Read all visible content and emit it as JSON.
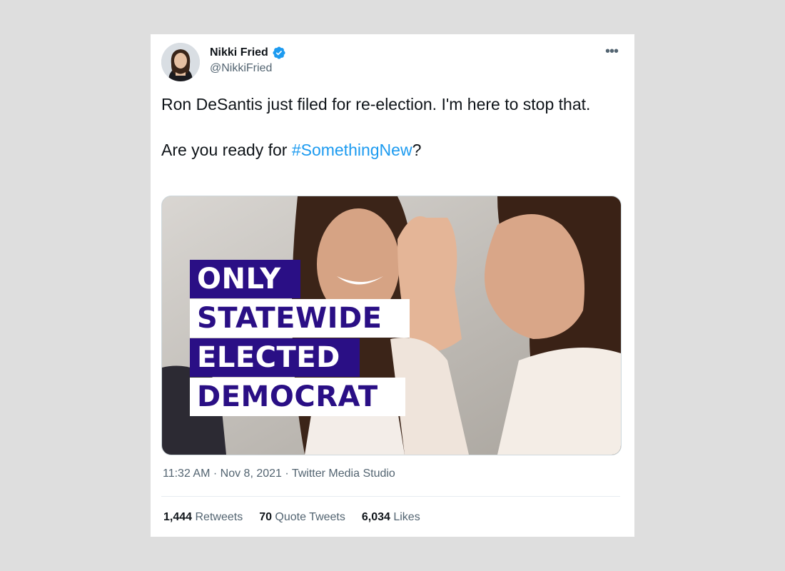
{
  "tweet": {
    "author": {
      "name": "Nikki Fried",
      "handle": "@NikkiFried",
      "verified": true
    },
    "more_icon": "more-horizontal-icon",
    "text_line1": "Ron DeSantis just filed for re-election. I'm here to stop that.",
    "text_line2_prefix": "Are you ready for ",
    "hashtag": "#SomethingNew",
    "text_line2_suffix": "?",
    "media": {
      "overlay_lines": [
        "ONLY",
        "STATEWIDE",
        "ELECTED",
        "DEMOCRAT"
      ]
    },
    "time": "11:32 AM",
    "date": "Nov 8, 2021",
    "source": "Twitter Media Studio",
    "separator": " · ",
    "stats": {
      "retweets_count": "1,444",
      "retweets_label": " Retweets",
      "quotes_count": "70",
      "quotes_label": " Quote Tweets",
      "likes_count": "6,034",
      "likes_label": " Likes"
    }
  },
  "colors": {
    "accent": "#1d9bf0",
    "overlay_purple": "#2a0f85",
    "page_bg": "#dedede"
  }
}
